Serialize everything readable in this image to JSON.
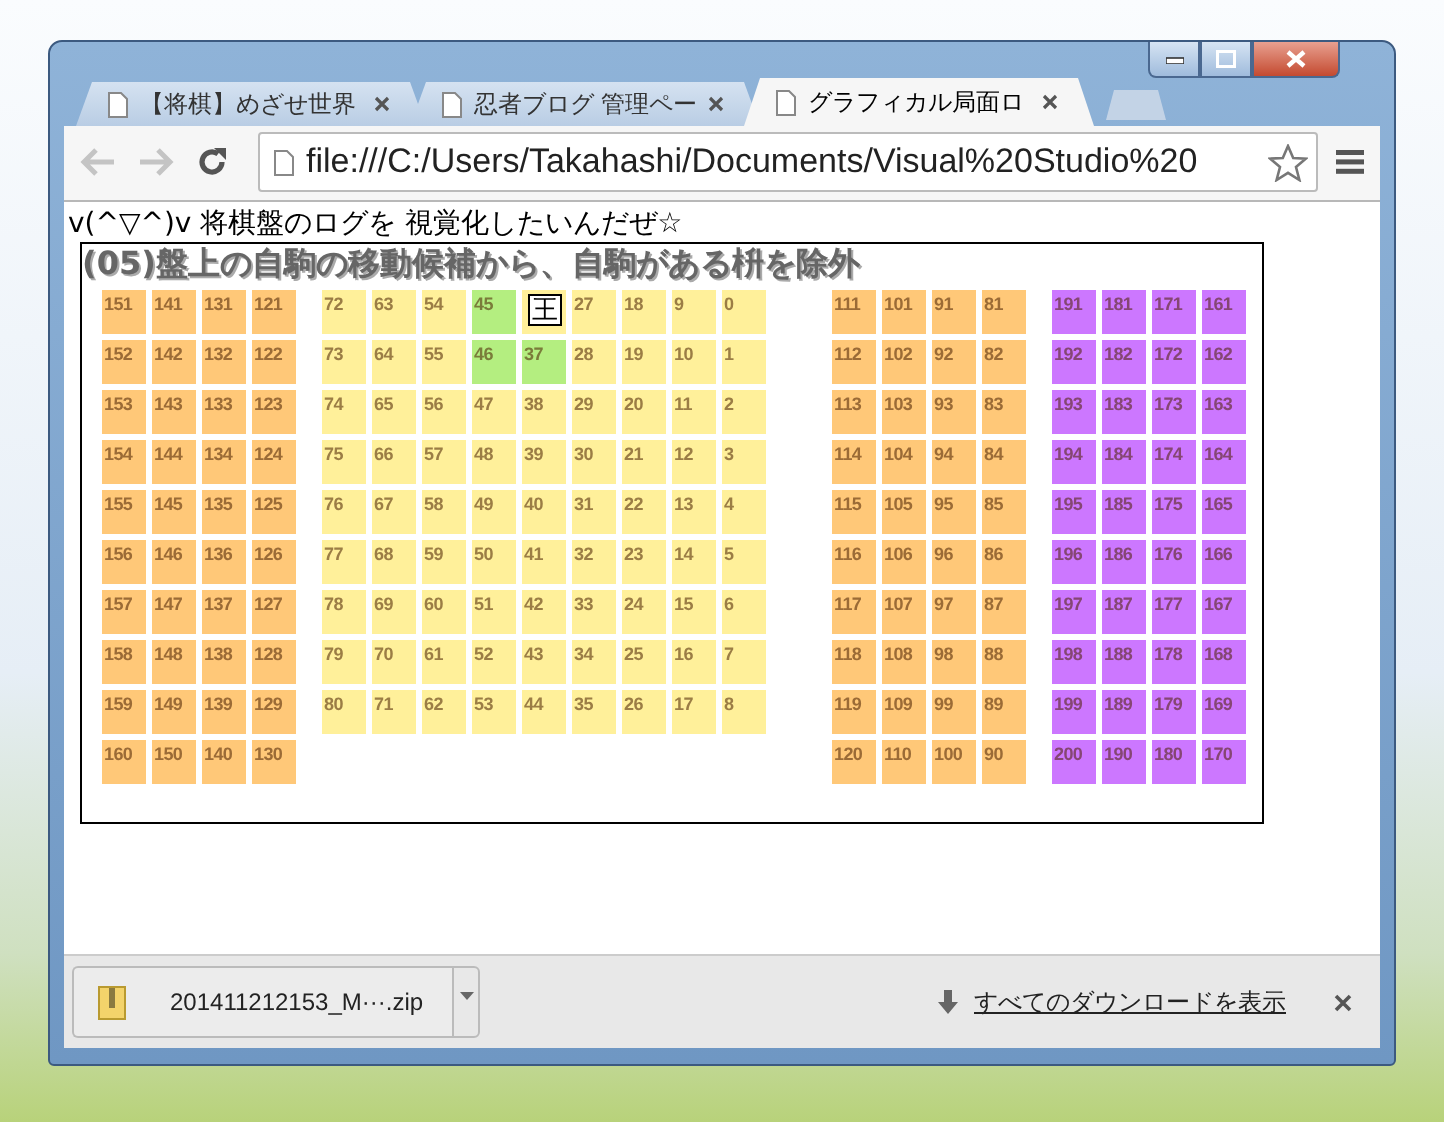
{
  "tabs": [
    {
      "label": "【将棋】めざせ世界",
      "selected": false
    },
    {
      "label": "忍者ブログ 管理ペー",
      "selected": false
    },
    {
      "label": "グラフィカル局面ロ",
      "selected": true
    }
  ],
  "toolbar": {
    "back_disabled": true,
    "forward_disabled": true,
    "url": "file:///C:/Users/Takahashi/Documents/Visual%20Studio%20"
  },
  "page": {
    "heading": "v(^▽^)v  将棋盤のログを  視覚化したいんだぜ☆",
    "board": {
      "title": "(05)盤上の自駒の移動候補から、自駒がある枡を除外",
      "blocks": [
        {
          "color": "#ffc878",
          "rows": [
            [
              {
                "text": "151",
                "kind": "number",
                "highlighted": false
              },
              {
                "text": "141",
                "kind": "number",
                "highlighted": false
              },
              {
                "text": "131",
                "kind": "number",
                "highlighted": false
              },
              {
                "text": "121",
                "kind": "number",
                "highlighted": false
              }
            ],
            [
              {
                "text": "152",
                "kind": "number",
                "highlighted": false
              },
              {
                "text": "142",
                "kind": "number",
                "highlighted": false
              },
              {
                "text": "132",
                "kind": "number",
                "highlighted": false
              },
              {
                "text": "122",
                "kind": "number",
                "highlighted": false
              }
            ],
            [
              {
                "text": "153",
                "kind": "number",
                "highlighted": false
              },
              {
                "text": "143",
                "kind": "number",
                "highlighted": false
              },
              {
                "text": "133",
                "kind": "number",
                "highlighted": false
              },
              {
                "text": "123",
                "kind": "number",
                "highlighted": false
              }
            ],
            [
              {
                "text": "154",
                "kind": "number",
                "highlighted": false
              },
              {
                "text": "144",
                "kind": "number",
                "highlighted": false
              },
              {
                "text": "134",
                "kind": "number",
                "highlighted": false
              },
              {
                "text": "124",
                "kind": "number",
                "highlighted": false
              }
            ],
            [
              {
                "text": "155",
                "kind": "number",
                "highlighted": false
              },
              {
                "text": "145",
                "kind": "number",
                "highlighted": false
              },
              {
                "text": "135",
                "kind": "number",
                "highlighted": false
              },
              {
                "text": "125",
                "kind": "number",
                "highlighted": false
              }
            ],
            [
              {
                "text": "156",
                "kind": "number",
                "highlighted": false
              },
              {
                "text": "146",
                "kind": "number",
                "highlighted": false
              },
              {
                "text": "136",
                "kind": "number",
                "highlighted": false
              },
              {
                "text": "126",
                "kind": "number",
                "highlighted": false
              }
            ],
            [
              {
                "text": "157",
                "kind": "number",
                "highlighted": false
              },
              {
                "text": "147",
                "kind": "number",
                "highlighted": false
              },
              {
                "text": "137",
                "kind": "number",
                "highlighted": false
              },
              {
                "text": "127",
                "kind": "number",
                "highlighted": false
              }
            ],
            [
              {
                "text": "158",
                "kind": "number",
                "highlighted": false
              },
              {
                "text": "148",
                "kind": "number",
                "highlighted": false
              },
              {
                "text": "138",
                "kind": "number",
                "highlighted": false
              },
              {
                "text": "128",
                "kind": "number",
                "highlighted": false
              }
            ],
            [
              {
                "text": "159",
                "kind": "number",
                "highlighted": false
              },
              {
                "text": "149",
                "kind": "number",
                "highlighted": false
              },
              {
                "text": "139",
                "kind": "number",
                "highlighted": false
              },
              {
                "text": "129",
                "kind": "number",
                "highlighted": false
              }
            ],
            [
              {
                "text": "160",
                "kind": "number",
                "highlighted": false
              },
              {
                "text": "150",
                "kind": "number",
                "highlighted": false
              },
              {
                "text": "140",
                "kind": "number",
                "highlighted": false
              },
              {
                "text": "130",
                "kind": "number",
                "highlighted": false
              }
            ]
          ]
        },
        {
          "color": "#fff09a",
          "rows": [
            [
              {
                "text": "72",
                "kind": "number",
                "highlighted": false
              },
              {
                "text": "63",
                "kind": "number",
                "highlighted": false
              },
              {
                "text": "54",
                "kind": "number",
                "highlighted": false
              },
              {
                "text": "45",
                "kind": "number",
                "highlighted": true
              },
              {
                "text": "王",
                "kind": "piece",
                "highlighted": false
              },
              {
                "text": "27",
                "kind": "number",
                "highlighted": false
              },
              {
                "text": "18",
                "kind": "number",
                "highlighted": false
              },
              {
                "text": "9",
                "kind": "number",
                "highlighted": false
              },
              {
                "text": "0",
                "kind": "number",
                "highlighted": false
              }
            ],
            [
              {
                "text": "73",
                "kind": "number",
                "highlighted": false
              },
              {
                "text": "64",
                "kind": "number",
                "highlighted": false
              },
              {
                "text": "55",
                "kind": "number",
                "highlighted": false
              },
              {
                "text": "46",
                "kind": "number",
                "highlighted": true
              },
              {
                "text": "37",
                "kind": "number",
                "highlighted": true
              },
              {
                "text": "28",
                "kind": "number",
                "highlighted": false
              },
              {
                "text": "19",
                "kind": "number",
                "highlighted": false
              },
              {
                "text": "10",
                "kind": "number",
                "highlighted": false
              },
              {
                "text": "1",
                "kind": "number",
                "highlighted": false
              }
            ],
            [
              {
                "text": "74",
                "kind": "number",
                "highlighted": false
              },
              {
                "text": "65",
                "kind": "number",
                "highlighted": false
              },
              {
                "text": "56",
                "kind": "number",
                "highlighted": false
              },
              {
                "text": "47",
                "kind": "number",
                "highlighted": false
              },
              {
                "text": "38",
                "kind": "number",
                "highlighted": false
              },
              {
                "text": "29",
                "kind": "number",
                "highlighted": false
              },
              {
                "text": "20",
                "kind": "number",
                "highlighted": false
              },
              {
                "text": "11",
                "kind": "number",
                "highlighted": false
              },
              {
                "text": "2",
                "kind": "number",
                "highlighted": false
              }
            ],
            [
              {
                "text": "75",
                "kind": "number",
                "highlighted": false
              },
              {
                "text": "66",
                "kind": "number",
                "highlighted": false
              },
              {
                "text": "57",
                "kind": "number",
                "highlighted": false
              },
              {
                "text": "48",
                "kind": "number",
                "highlighted": false
              },
              {
                "text": "39",
                "kind": "number",
                "highlighted": false
              },
              {
                "text": "30",
                "kind": "number",
                "highlighted": false
              },
              {
                "text": "21",
                "kind": "number",
                "highlighted": false
              },
              {
                "text": "12",
                "kind": "number",
                "highlighted": false
              },
              {
                "text": "3",
                "kind": "number",
                "highlighted": false
              }
            ],
            [
              {
                "text": "76",
                "kind": "number",
                "highlighted": false
              },
              {
                "text": "67",
                "kind": "number",
                "highlighted": false
              },
              {
                "text": "58",
                "kind": "number",
                "highlighted": false
              },
              {
                "text": "49",
                "kind": "number",
                "highlighted": false
              },
              {
                "text": "40",
                "kind": "number",
                "highlighted": false
              },
              {
                "text": "31",
                "kind": "number",
                "highlighted": false
              },
              {
                "text": "22",
                "kind": "number",
                "highlighted": false
              },
              {
                "text": "13",
                "kind": "number",
                "highlighted": false
              },
              {
                "text": "4",
                "kind": "number",
                "highlighted": false
              }
            ],
            [
              {
                "text": "77",
                "kind": "number",
                "highlighted": false
              },
              {
                "text": "68",
                "kind": "number",
                "highlighted": false
              },
              {
                "text": "59",
                "kind": "number",
                "highlighted": false
              },
              {
                "text": "50",
                "kind": "number",
                "highlighted": false
              },
              {
                "text": "41",
                "kind": "number",
                "highlighted": false
              },
              {
                "text": "32",
                "kind": "number",
                "highlighted": false
              },
              {
                "text": "23",
                "kind": "number",
                "highlighted": false
              },
              {
                "text": "14",
                "kind": "number",
                "highlighted": false
              },
              {
                "text": "5",
                "kind": "number",
                "highlighted": false
              }
            ],
            [
              {
                "text": "78",
                "kind": "number",
                "highlighted": false
              },
              {
                "text": "69",
                "kind": "number",
                "highlighted": false
              },
              {
                "text": "60",
                "kind": "number",
                "highlighted": false
              },
              {
                "text": "51",
                "kind": "number",
                "highlighted": false
              },
              {
                "text": "42",
                "kind": "number",
                "highlighted": false
              },
              {
                "text": "33",
                "kind": "number",
                "highlighted": false
              },
              {
                "text": "24",
                "kind": "number",
                "highlighted": false
              },
              {
                "text": "15",
                "kind": "number",
                "highlighted": false
              },
              {
                "text": "6",
                "kind": "number",
                "highlighted": false
              }
            ],
            [
              {
                "text": "79",
                "kind": "number",
                "highlighted": false
              },
              {
                "text": "70",
                "kind": "number",
                "highlighted": false
              },
              {
                "text": "61",
                "kind": "number",
                "highlighted": false
              },
              {
                "text": "52",
                "kind": "number",
                "highlighted": false
              },
              {
                "text": "43",
                "kind": "number",
                "highlighted": false
              },
              {
                "text": "34",
                "kind": "number",
                "highlighted": false
              },
              {
                "text": "25",
                "kind": "number",
                "highlighted": false
              },
              {
                "text": "16",
                "kind": "number",
                "highlighted": false
              },
              {
                "text": "7",
                "kind": "number",
                "highlighted": false
              }
            ],
            [
              {
                "text": "80",
                "kind": "number",
                "highlighted": false
              },
              {
                "text": "71",
                "kind": "number",
                "highlighted": false
              },
              {
                "text": "62",
                "kind": "number",
                "highlighted": false
              },
              {
                "text": "53",
                "kind": "number",
                "highlighted": false
              },
              {
                "text": "44",
                "kind": "number",
                "highlighted": false
              },
              {
                "text": "35",
                "kind": "number",
                "highlighted": false
              },
              {
                "text": "26",
                "kind": "number",
                "highlighted": false
              },
              {
                "text": "17",
                "kind": "number",
                "highlighted": false
              },
              {
                "text": "8",
                "kind": "number",
                "highlighted": false
              }
            ]
          ]
        },
        {
          "color": "#ffc878",
          "rows": [
            [
              {
                "text": "111",
                "kind": "number",
                "highlighted": false
              },
              {
                "text": "101",
                "kind": "number",
                "highlighted": false
              },
              {
                "text": "91",
                "kind": "number",
                "highlighted": false
              },
              {
                "text": "81",
                "kind": "number",
                "highlighted": false
              }
            ],
            [
              {
                "text": "112",
                "kind": "number",
                "highlighted": false
              },
              {
                "text": "102",
                "kind": "number",
                "highlighted": false
              },
              {
                "text": "92",
                "kind": "number",
                "highlighted": false
              },
              {
                "text": "82",
                "kind": "number",
                "highlighted": false
              }
            ],
            [
              {
                "text": "113",
                "kind": "number",
                "highlighted": false
              },
              {
                "text": "103",
                "kind": "number",
                "highlighted": false
              },
              {
                "text": "93",
                "kind": "number",
                "highlighted": false
              },
              {
                "text": "83",
                "kind": "number",
                "highlighted": false
              }
            ],
            [
              {
                "text": "114",
                "kind": "number",
                "highlighted": false
              },
              {
                "text": "104",
                "kind": "number",
                "highlighted": false
              },
              {
                "text": "94",
                "kind": "number",
                "highlighted": false
              },
              {
                "text": "84",
                "kind": "number",
                "highlighted": false
              }
            ],
            [
              {
                "text": "115",
                "kind": "number",
                "highlighted": false
              },
              {
                "text": "105",
                "kind": "number",
                "highlighted": false
              },
              {
                "text": "95",
                "kind": "number",
                "highlighted": false
              },
              {
                "text": "85",
                "kind": "number",
                "highlighted": false
              }
            ],
            [
              {
                "text": "116",
                "kind": "number",
                "highlighted": false
              },
              {
                "text": "106",
                "kind": "number",
                "highlighted": false
              },
              {
                "text": "96",
                "kind": "number",
                "highlighted": false
              },
              {
                "text": "86",
                "kind": "number",
                "highlighted": false
              }
            ],
            [
              {
                "text": "117",
                "kind": "number",
                "highlighted": false
              },
              {
                "text": "107",
                "kind": "number",
                "highlighted": false
              },
              {
                "text": "97",
                "kind": "number",
                "highlighted": false
              },
              {
                "text": "87",
                "kind": "number",
                "highlighted": false
              }
            ],
            [
              {
                "text": "118",
                "kind": "number",
                "highlighted": false
              },
              {
                "text": "108",
                "kind": "number",
                "highlighted": false
              },
              {
                "text": "98",
                "kind": "number",
                "highlighted": false
              },
              {
                "text": "88",
                "kind": "number",
                "highlighted": false
              }
            ],
            [
              {
                "text": "119",
                "kind": "number",
                "highlighted": false
              },
              {
                "text": "109",
                "kind": "number",
                "highlighted": false
              },
              {
                "text": "99",
                "kind": "number",
                "highlighted": false
              },
              {
                "text": "89",
                "kind": "number",
                "highlighted": false
              }
            ],
            [
              {
                "text": "120",
                "kind": "number",
                "highlighted": false
              },
              {
                "text": "110",
                "kind": "number",
                "highlighted": false
              },
              {
                "text": "100",
                "kind": "number",
                "highlighted": false
              },
              {
                "text": "90",
                "kind": "number",
                "highlighted": false
              }
            ]
          ]
        },
        {
          "color": "#cc77ff",
          "rows": [
            [
              {
                "text": "191",
                "kind": "number",
                "highlighted": false
              },
              {
                "text": "181",
                "kind": "number",
                "highlighted": false
              },
              {
                "text": "171",
                "kind": "number",
                "highlighted": false
              },
              {
                "text": "161",
                "kind": "number",
                "highlighted": false
              }
            ],
            [
              {
                "text": "192",
                "kind": "number",
                "highlighted": false
              },
              {
                "text": "182",
                "kind": "number",
                "highlighted": false
              },
              {
                "text": "172",
                "kind": "number",
                "highlighted": false
              },
              {
                "text": "162",
                "kind": "number",
                "highlighted": false
              }
            ],
            [
              {
                "text": "193",
                "kind": "number",
                "highlighted": false
              },
              {
                "text": "183",
                "kind": "number",
                "highlighted": false
              },
              {
                "text": "173",
                "kind": "number",
                "highlighted": false
              },
              {
                "text": "163",
                "kind": "number",
                "highlighted": false
              }
            ],
            [
              {
                "text": "194",
                "kind": "number",
                "highlighted": false
              },
              {
                "text": "184",
                "kind": "number",
                "highlighted": false
              },
              {
                "text": "174",
                "kind": "number",
                "highlighted": false
              },
              {
                "text": "164",
                "kind": "number",
                "highlighted": false
              }
            ],
            [
              {
                "text": "195",
                "kind": "number",
                "highlighted": false
              },
              {
                "text": "185",
                "kind": "number",
                "highlighted": false
              },
              {
                "text": "175",
                "kind": "number",
                "highlighted": false
              },
              {
                "text": "165",
                "kind": "number",
                "highlighted": false
              }
            ],
            [
              {
                "text": "196",
                "kind": "number",
                "highlighted": false
              },
              {
                "text": "186",
                "kind": "number",
                "highlighted": false
              },
              {
                "text": "176",
                "kind": "number",
                "highlighted": false
              },
              {
                "text": "166",
                "kind": "number",
                "highlighted": false
              }
            ],
            [
              {
                "text": "197",
                "kind": "number",
                "highlighted": false
              },
              {
                "text": "187",
                "kind": "number",
                "highlighted": false
              },
              {
                "text": "177",
                "kind": "number",
                "highlighted": false
              },
              {
                "text": "167",
                "kind": "number",
                "highlighted": false
              }
            ],
            [
              {
                "text": "198",
                "kind": "number",
                "highlighted": false
              },
              {
                "text": "188",
                "kind": "number",
                "highlighted": false
              },
              {
                "text": "178",
                "kind": "number",
                "highlighted": false
              },
              {
                "text": "168",
                "kind": "number",
                "highlighted": false
              }
            ],
            [
              {
                "text": "199",
                "kind": "number",
                "highlighted": false
              },
              {
                "text": "189",
                "kind": "number",
                "highlighted": false
              },
              {
                "text": "179",
                "kind": "number",
                "highlighted": false
              },
              {
                "text": "169",
                "kind": "number",
                "highlighted": false
              }
            ],
            [
              {
                "text": "200",
                "kind": "number",
                "highlighted": false
              },
              {
                "text": "190",
                "kind": "number",
                "highlighted": false
              },
              {
                "text": "180",
                "kind": "number",
                "highlighted": false
              },
              {
                "text": "170",
                "kind": "number",
                "highlighted": false
              }
            ]
          ]
        }
      ]
    }
  },
  "download_bar": {
    "file": "201411212153_M···.zip",
    "show_all": "すべてのダウンロードを表示"
  }
}
